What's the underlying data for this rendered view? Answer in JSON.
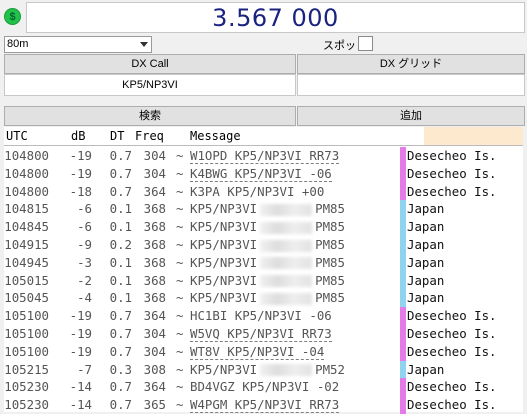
{
  "header": {
    "status_icon_text": "$",
    "frequency": "3.567 000"
  },
  "controls": {
    "band": "80m",
    "spot_label": "スポット",
    "dx_call_label": "DX Call",
    "dx_grid_label": "DX グリッド",
    "dx_call_value": "KP5/NP3VI",
    "dx_grid_value": "",
    "search_label": "検索",
    "add_label": "追加"
  },
  "table": {
    "columns": [
      "UTC",
      "dB",
      "DT",
      "Freq",
      "Message"
    ],
    "colors": {
      "magenta": "#e57be6",
      "cyan": "#8fd3ef"
    },
    "rows": [
      {
        "utc": "104800",
        "db": "-19",
        "dt": "0.7",
        "freq": "304",
        "sep": "~",
        "msg": "W1OPD KP5/NP3VI RR73",
        "underline": true,
        "blur": false,
        "tail": "",
        "loc": "Desecheo Is.",
        "bar": "magenta"
      },
      {
        "utc": "104800",
        "db": "-19",
        "dt": "0.7",
        "freq": "304",
        "sep": "~",
        "msg": "K4BWG KP5/NP3VI -06",
        "underline": true,
        "blur": false,
        "tail": "",
        "loc": "Desecheo Is.",
        "bar": "magenta"
      },
      {
        "utc": "104800",
        "db": "-18",
        "dt": "0.7",
        "freq": "364",
        "sep": "~",
        "msg": "K3PA KP5/NP3VI +00",
        "underline": false,
        "blur": false,
        "tail": "",
        "loc": "Desecheo Is.",
        "bar": "magenta"
      },
      {
        "utc": "104815",
        "db": "-6",
        "dt": "0.1",
        "freq": "368",
        "sep": "~",
        "msg": "KP5/NP3VI",
        "underline": false,
        "blur": true,
        "tail": "PM85",
        "loc": "Japan",
        "bar": "cyan"
      },
      {
        "utc": "104845",
        "db": "-6",
        "dt": "0.1",
        "freq": "368",
        "sep": "~",
        "msg": "KP5/NP3VI",
        "underline": false,
        "blur": true,
        "tail": "PM85",
        "loc": "Japan",
        "bar": "cyan"
      },
      {
        "utc": "104915",
        "db": "-9",
        "dt": "0.2",
        "freq": "368",
        "sep": "~",
        "msg": "KP5/NP3VI",
        "underline": false,
        "blur": true,
        "tail": "PM85",
        "loc": "Japan",
        "bar": "cyan"
      },
      {
        "utc": "104945",
        "db": "-3",
        "dt": "0.1",
        "freq": "368",
        "sep": "~",
        "msg": "KP5/NP3VI",
        "underline": false,
        "blur": true,
        "tail": "PM85",
        "loc": "Japan",
        "bar": "cyan"
      },
      {
        "utc": "105015",
        "db": "-2",
        "dt": "0.1",
        "freq": "368",
        "sep": "~",
        "msg": "KP5/NP3VI",
        "underline": false,
        "blur": true,
        "tail": "PM85",
        "loc": "Japan",
        "bar": "cyan"
      },
      {
        "utc": "105045",
        "db": "-4",
        "dt": "0.1",
        "freq": "368",
        "sep": "~",
        "msg": "KP5/NP3VI",
        "underline": false,
        "blur": true,
        "tail": "PM85",
        "loc": "Japan",
        "bar": "cyan"
      },
      {
        "utc": "105100",
        "db": "-19",
        "dt": "0.7",
        "freq": "364",
        "sep": "~",
        "msg": "HC1BI KP5/NP3VI -06",
        "underline": false,
        "blur": false,
        "tail": "",
        "loc": "Desecheo Is.",
        "bar": "magenta"
      },
      {
        "utc": "105100",
        "db": "-19",
        "dt": "0.7",
        "freq": "304",
        "sep": "~",
        "msg": "W5VQ KP5/NP3VI RR73",
        "underline": true,
        "blur": false,
        "tail": "",
        "loc": "Desecheo Is.",
        "bar": "magenta"
      },
      {
        "utc": "105100",
        "db": "-19",
        "dt": "0.7",
        "freq": "304",
        "sep": "~",
        "msg": "WT8V KP5/NP3VI -04",
        "underline": true,
        "blur": false,
        "tail": "",
        "loc": "Desecheo Is.",
        "bar": "magenta"
      },
      {
        "utc": "105215",
        "db": "-7",
        "dt": "0.3",
        "freq": "308",
        "sep": "~",
        "msg": "KP5/NP3VI",
        "underline": false,
        "blur": true,
        "tail": "PM52",
        "loc": "Japan",
        "bar": "cyan"
      },
      {
        "utc": "105230",
        "db": "-14",
        "dt": "0.7",
        "freq": "364",
        "sep": "~",
        "msg": "BD4VGZ KP5/NP3VI -02",
        "underline": false,
        "blur": false,
        "tail": "",
        "loc": "Desecheo Is.",
        "bar": "magenta"
      },
      {
        "utc": "105230",
        "db": "-14",
        "dt": "0.7",
        "freq": "365",
        "sep": "~",
        "msg": "W4PGM KP5/NP3VI RR73",
        "underline": true,
        "blur": false,
        "tail": "",
        "loc": "Desecheo Is.",
        "bar": "magenta"
      }
    ]
  }
}
